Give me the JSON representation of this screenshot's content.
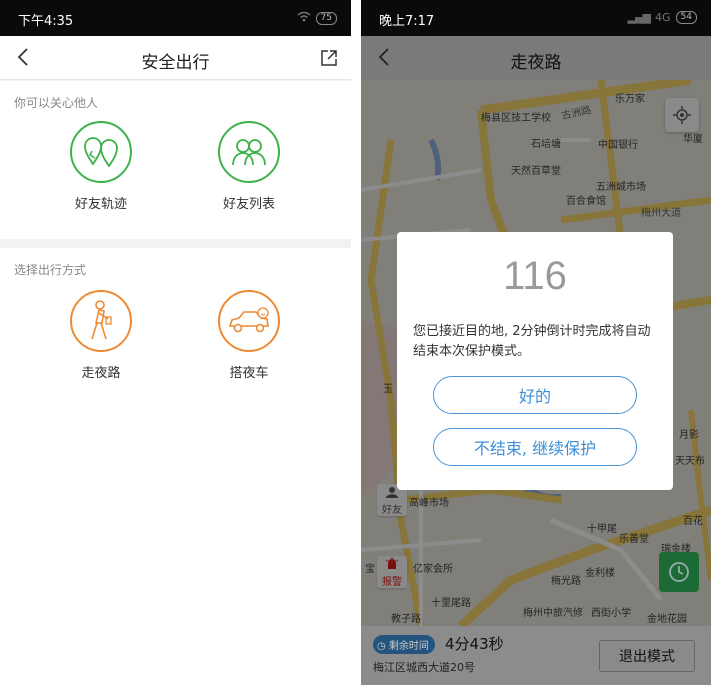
{
  "left": {
    "status_time": "下午4:35",
    "battery": "75",
    "title": "安全出行",
    "section1_label": "你可以关心他人",
    "friend_track": "好友轨迹",
    "friend_list": "好友列表",
    "section2_label": "选择出行方式",
    "walk_night": "走夜路",
    "night_car": "搭夜车"
  },
  "right": {
    "status_time": "晚上7:17",
    "network": "4G",
    "battery": "54",
    "title": "走夜路",
    "map_pois": [
      "乐万家",
      "梅县区技工学校",
      "石培塘",
      "中国银行",
      "天然百草堂",
      "五洲城市场",
      "百合食馆",
      "华厦",
      "梅州大道",
      "高峰市场",
      "十甲尾",
      "乐善堂",
      "金利楼",
      "亿家会所",
      "十里尾路",
      "梅州中旅汽修",
      "西街小学",
      "教子路",
      "金地花园",
      "月影",
      "天天布",
      "百花",
      "瑞金楼",
      "梅光路",
      "古洲路",
      "宝",
      "玉"
    ],
    "friend_btn": "好友",
    "alarm_btn": "报警",
    "remain_label": "剩余时间",
    "remain_value": "4分43秒",
    "address": "梅江区城西大道20号",
    "exit_btn": "退出模式",
    "dialog": {
      "countdown": "116",
      "message": "您已接近目的地, 2分钟倒计时完成将自动结束本次保护模式。",
      "ok_btn": "好的",
      "continue_btn": "不结束, 继续保护"
    }
  }
}
